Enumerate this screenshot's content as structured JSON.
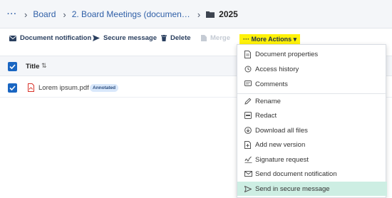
{
  "breadcrumb": {
    "ellipsis": "···",
    "items": [
      "Board",
      "2. Board Meetings (documen…",
      "2025"
    ]
  },
  "toolbar": {
    "document_notification": "Document notification",
    "secure_message": "Secure message",
    "delete": "Delete",
    "merge": "Merge",
    "more_actions": "··· More Actions ▾"
  },
  "table": {
    "columns": [
      "Title"
    ],
    "sort_icon": "⇅",
    "rows": [
      {
        "name": "Lorem ipsum.pdf",
        "badge": "Annotated"
      }
    ]
  },
  "menu": {
    "items": [
      {
        "label": "Document properties",
        "icon": "document-icon"
      },
      {
        "label": "Access history",
        "icon": "history-icon"
      },
      {
        "label": "Comments",
        "icon": "comment-icon"
      },
      {
        "label": "Rename",
        "icon": "pencil-icon"
      },
      {
        "label": "Redact",
        "icon": "redact-icon"
      },
      {
        "label": "Download all files",
        "icon": "download-icon"
      },
      {
        "label": "Add new version",
        "icon": "add-version-icon"
      },
      {
        "label": "Signature request",
        "icon": "signature-icon"
      },
      {
        "label": "Send document notification",
        "icon": "envelope-icon"
      },
      {
        "label": "Send in secure message",
        "icon": "send-icon"
      }
    ],
    "highlighted": "Send in secure message"
  },
  "colors": {
    "accent": "#1a66c2",
    "link": "#2f5fa7",
    "highlight_yellow": "#fff20a",
    "menu_active": "#cdeee3",
    "pdf_red": "#d9342b"
  }
}
